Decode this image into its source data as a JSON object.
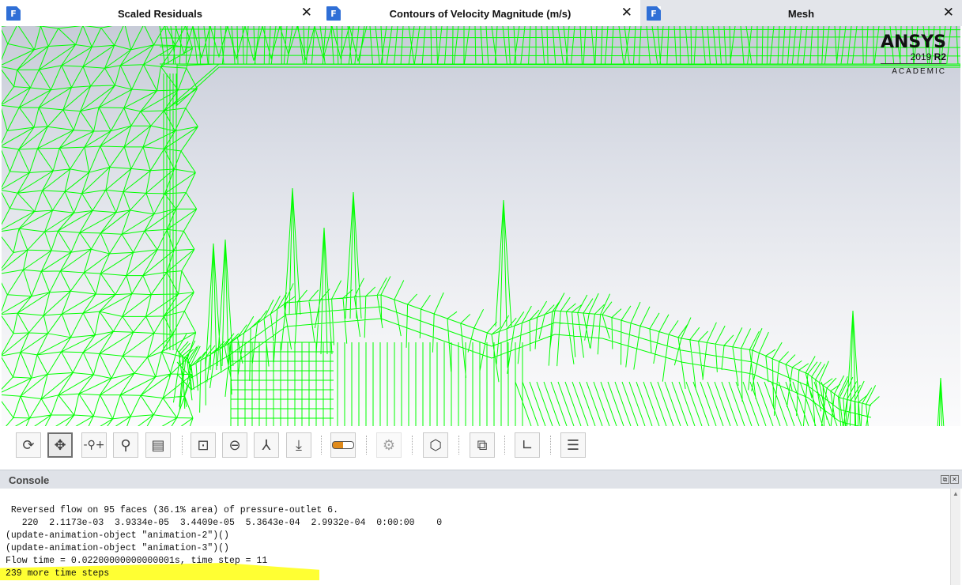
{
  "tabs": [
    {
      "label": "Scaled Residuals",
      "icon": "F",
      "close": "✕"
    },
    {
      "label": "Contours of Velocity Magnitude (m/s)",
      "icon": "F",
      "close": "✕"
    },
    {
      "label": "Mesh",
      "icon": "F",
      "close": "✕"
    }
  ],
  "logo": {
    "brand": "ANSYS",
    "version_year": "2019",
    "version_rel": "R2",
    "edition": "ACADEMIC"
  },
  "toolbar": {
    "icons": [
      "rotate-icon",
      "pan-icon",
      "zoom-in-out-icon",
      "zoom-icon",
      "zoom-to-area-icon",
      "fit-to-window-icon",
      "zoom-out-icon",
      "axes-orientation-icon",
      "view-import-icon",
      "colormap-icon",
      "lighting-icon",
      "isometric-view-icon",
      "view-box-icon",
      "xy-plot-icon",
      "report-icon"
    ]
  },
  "console": {
    "title": "Console",
    "lines": [
      " Reversed flow on 95 faces (36.1% area) of pressure-outlet 6.",
      "   220  2.1173e-03  3.9334e-05  3.4409e-05  5.3643e-04  2.9932e-04  0:00:00    0",
      "(update-animation-object \"animation-2\")()",
      "(update-animation-object \"animation-3\")()",
      "Flow time = 0.02200000000000001s, time step = 11",
      "239 more time steps"
    ]
  },
  "colors": {
    "mesh": "#00ff00",
    "highlight": "#ffff33",
    "tab_icon": "#2f6fd6"
  }
}
